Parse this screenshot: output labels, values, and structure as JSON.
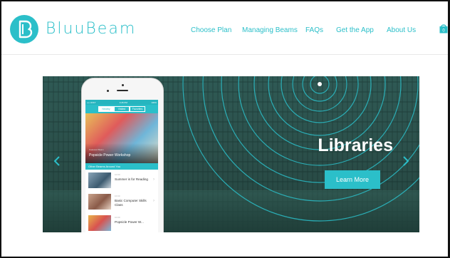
{
  "brand": {
    "name": "BluuBeam",
    "color": "#2bbfc9"
  },
  "nav": {
    "items": [
      {
        "label": "Choose Plan"
      },
      {
        "label": "Managing Beams"
      },
      {
        "label": "FAQs"
      },
      {
        "label": "Get the App"
      },
      {
        "label": "About Us"
      }
    ],
    "cart_count": "0"
  },
  "hero": {
    "title": "Libraries",
    "button_label": "Learn More",
    "prev_icon": "chevron-left-icon",
    "next_icon": "chevron-right-icon"
  },
  "phone": {
    "status": {
      "carrier": "•••• AT&T",
      "time": "4:26 PM",
      "battery": "100%"
    },
    "tabs": [
      {
        "label": "Nearby",
        "active": true
      },
      {
        "label": "Visited",
        "active": false
      },
      {
        "label": "Favorites",
        "active": false
      }
    ],
    "featured": {
      "tag": "Featured Beam",
      "title": "Popsicle Power Workshop"
    },
    "section_header": "Other Beams Around You",
    "list": [
      {
        "meta": "10:00",
        "title": "Summer is for Reading"
      },
      {
        "meta": "10:00",
        "title": "Basic Computer Skills Class"
      },
      {
        "meta": "10:00",
        "title": "Popsicle Power W..."
      }
    ]
  }
}
